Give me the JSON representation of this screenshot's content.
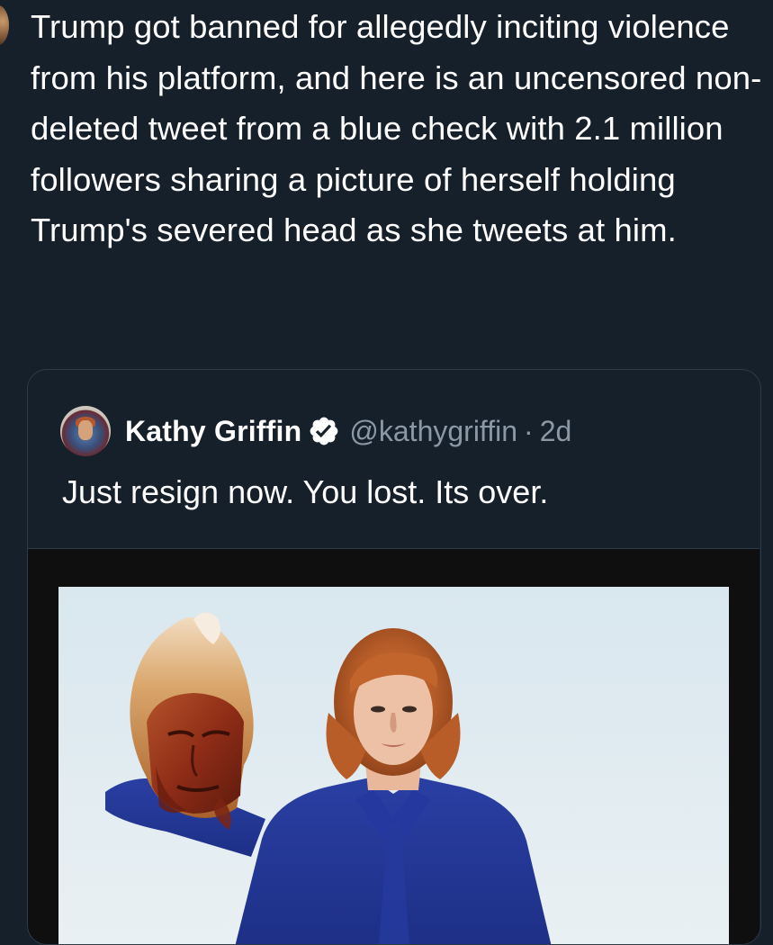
{
  "post": {
    "text": "Trump got banned for allegedly inciting violence from his platform, and here is an uncensored non-deleted tweet from a blue check with 2.1 million followers sharing a picture of herself holding Trump's severed head as she tweets at him."
  },
  "quoted_tweet": {
    "display_name": "Kathy Griffin",
    "verified_icon": "verified-badge-icon",
    "handle": "@kathygriffin",
    "separator": "·",
    "time": "2d",
    "text": "Just resign now. You lost. Its over."
  },
  "colors": {
    "background": "#15202b",
    "text_primary": "#ffffff",
    "text_secondary": "#8b98a5",
    "border": "#2f3b47"
  }
}
